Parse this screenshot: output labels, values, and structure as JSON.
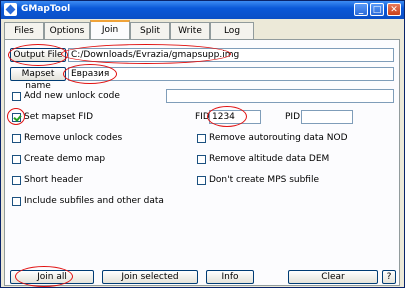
{
  "window": {
    "title": "GMapTool",
    "minimize": "_",
    "maximize": "□",
    "close": "✕"
  },
  "tabs": [
    {
      "label": "Files"
    },
    {
      "label": "Options"
    },
    {
      "label": "Join"
    },
    {
      "label": "Split"
    },
    {
      "label": "Write"
    },
    {
      "label": "Log"
    }
  ],
  "active_tab": "Join",
  "join": {
    "output_file_button": "Output File",
    "output_file_value": "C:/Downloads/Evrazia/gmapsupp.img",
    "mapset_name_label": "Mapset name",
    "mapset_name_value": "Евразия",
    "add_unlock_code_label": "Add new unlock code",
    "add_unlock_code_value": "",
    "set_mapset_fid_label": "Set mapset FID",
    "fid_label": "FID",
    "fid_value": "1234",
    "pid_label": "PID",
    "pid_value": "",
    "remove_unlock_codes_label": "Remove unlock codes",
    "remove_autorouting_label": "Remove autorouting data NOD",
    "create_demo_map_label": "Create demo map",
    "remove_altitude_label": "Remove altitude data DEM",
    "short_header_label": "Short header",
    "dont_create_mps_label": "Don't create MPS subfile",
    "include_subfiles_label": "Include subfiles and other data"
  },
  "checkboxes": {
    "add_unlock_code": false,
    "set_mapset_fid": true,
    "remove_unlock_codes": false,
    "remove_autorouting": false,
    "create_demo_map": false,
    "remove_altitude": false,
    "short_header": false,
    "dont_create_mps": false,
    "include_subfiles": false
  },
  "bottom_buttons": {
    "join_all": "Join all",
    "join_selected": "Join selected",
    "info": "Info",
    "clear": "Clear",
    "help": "?"
  },
  "annotation_color": "#e11111"
}
